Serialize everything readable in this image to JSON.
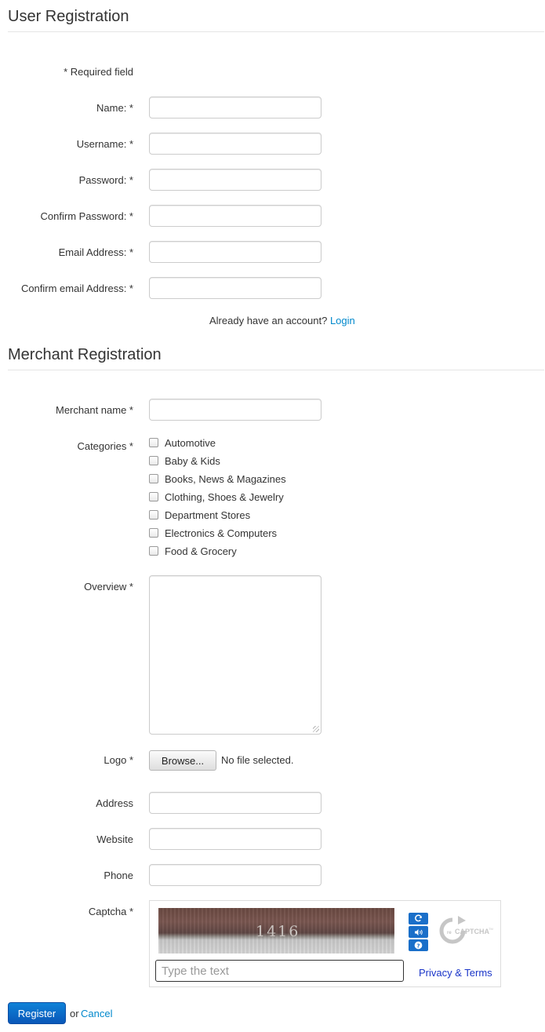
{
  "user_section": {
    "title": "User Registration",
    "required_note": "* Required field",
    "fields": [
      {
        "label": "Name: *",
        "value": ""
      },
      {
        "label": "Username: *",
        "value": ""
      },
      {
        "label": "Password: *",
        "value": ""
      },
      {
        "label": "Confirm Password: *",
        "value": ""
      },
      {
        "label": "Email Address: *",
        "value": ""
      },
      {
        "label": "Confirm email Address: *",
        "value": ""
      }
    ],
    "account_prompt": "Already have an account?",
    "login_link": "Login"
  },
  "merchant_section": {
    "title": "Merchant Registration",
    "merchant_name_label": "Merchant name *",
    "categories_label": "Categories *",
    "categories": [
      {
        "label": "Automotive",
        "checked": false
      },
      {
        "label": "Baby & Kids",
        "checked": false
      },
      {
        "label": "Books, News & Magazines",
        "checked": false
      },
      {
        "label": "Clothing, Shoes & Jewelry",
        "checked": false
      },
      {
        "label": "Department Stores",
        "checked": false
      },
      {
        "label": "Electronics & Computers",
        "checked": false
      },
      {
        "label": "Food & Grocery",
        "checked": false
      }
    ],
    "overview_label": "Overview *",
    "logo_label": "Logo *",
    "browse_button": "Browse...",
    "file_status": "No file selected.",
    "address_label": "Address",
    "website_label": "Website",
    "phone_label": "Phone",
    "captcha_label": "Captcha *"
  },
  "captcha": {
    "challenge_text": "1416",
    "placeholder": "Type the text",
    "privacy_link": "Privacy & Terms",
    "logo_icon": "recaptcha-logo-icon",
    "buttons": [
      "refresh-icon",
      "audio-icon",
      "help-icon"
    ],
    "accent_color": "#1a6fc9"
  },
  "actions": {
    "register_button": "Register",
    "or_text": "or",
    "cancel_link": "Cancel"
  },
  "colors": {
    "link": "#0088cc",
    "primary_button": "#0a6ac8",
    "text": "#333333"
  }
}
